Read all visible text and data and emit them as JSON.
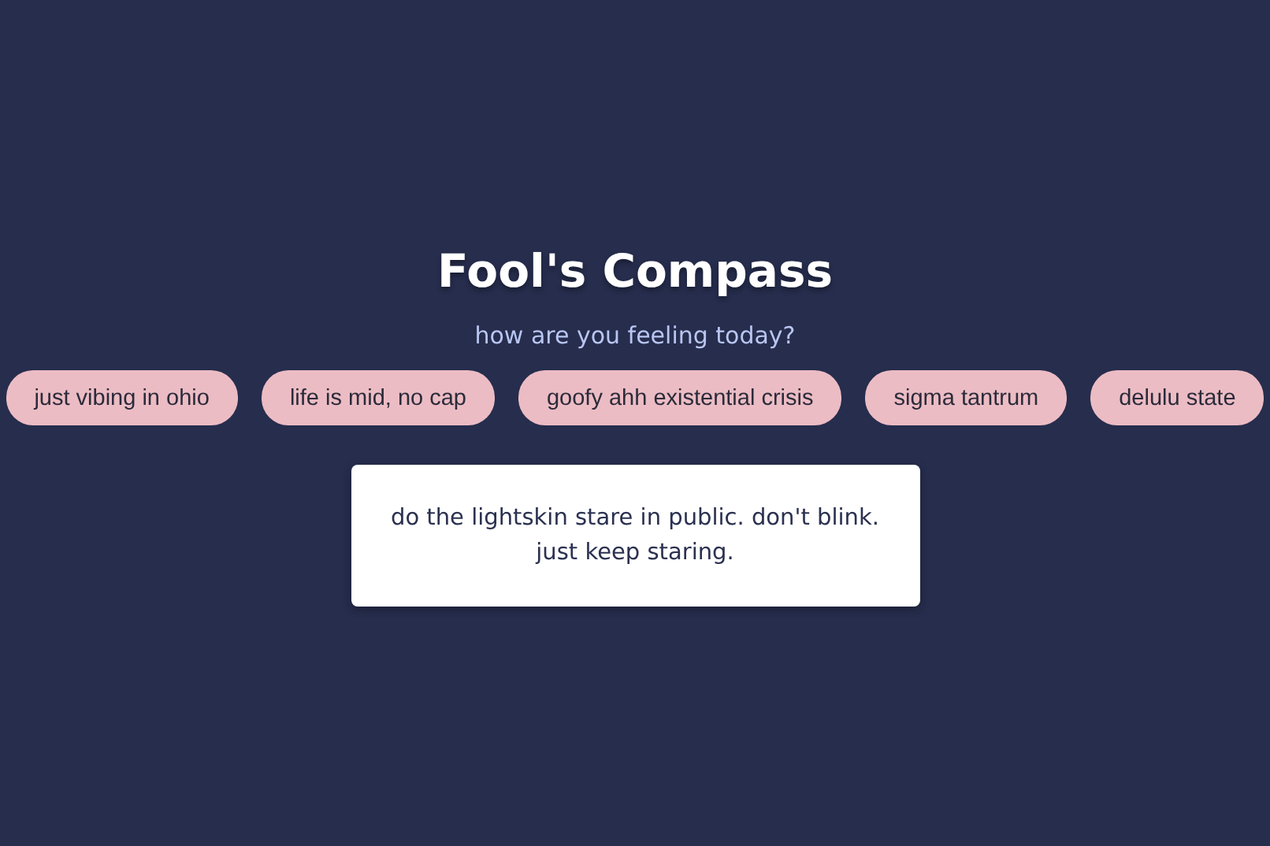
{
  "title": "Fool's Compass",
  "subtitle": "how are you feeling today?",
  "moods": [
    {
      "label": "just vibing in ohio"
    },
    {
      "label": "life is mid, no cap"
    },
    {
      "label": "goofy ahh existential crisis"
    },
    {
      "label": "sigma tantrum"
    },
    {
      "label": "delulu state"
    }
  ],
  "advice": "do the lightskin stare in public. don't blink. just keep staring."
}
